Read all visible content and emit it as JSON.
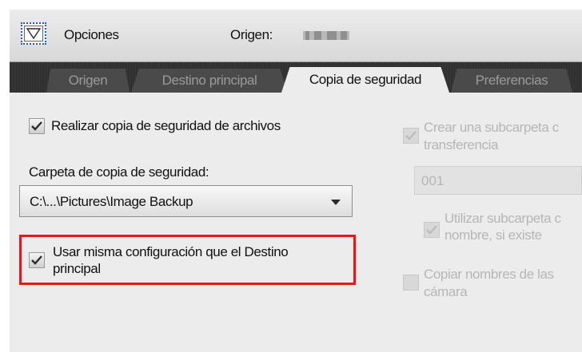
{
  "header": {
    "title": "Opciones",
    "origin_label": "Origen:",
    "toggle_icon": "chevron-down-icon"
  },
  "tabs": [
    {
      "label": "Origen",
      "active": false
    },
    {
      "label": "Destino principal",
      "active": false
    },
    {
      "label": "Copia de seguridad",
      "active": true
    },
    {
      "label": "Preferencias",
      "active": false
    }
  ],
  "backup": {
    "enable_label": "Realizar copia de seguridad de archivos",
    "enable_checked": true,
    "folder_label": "Carpeta de copia de seguridad:",
    "folder_value": "C:\\...\\Pictures\\Image Backup",
    "same_settings_label_1": "Usar misma configuración que el Destino",
    "same_settings_label_2": "principal",
    "same_settings_checked": true
  },
  "right_options": {
    "create_subfolder_label_1": "Crear una subcarpeta c",
    "create_subfolder_label_2": "transferencia",
    "create_subfolder_checked": true,
    "subfolder_name_value": "001",
    "use_subfolder_label_1": "Utilizar subcarpeta c",
    "use_subfolder_label_2": "nombre, si existe",
    "use_subfolder_checked": true,
    "copy_names_label_1": "Copiar nombres de las",
    "copy_names_label_2": "cámara",
    "copy_names_checked": false
  },
  "colors": {
    "highlight": "#e01b1b",
    "dark_chrome": "#343434",
    "panel_bg": "#ececec"
  }
}
